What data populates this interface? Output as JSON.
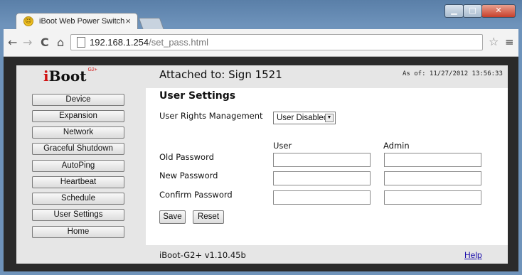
{
  "browser": {
    "tab_title": "iBoot Web Power Switch",
    "tab_close": "×",
    "url_host": "192.168.1.254",
    "url_path": "/set_pass.html"
  },
  "header": {
    "logo_text": "Boot",
    "logo_i": "i",
    "logo_sup": "G2+",
    "attached": "Attached to: Sign 1521",
    "as_of": "As of: 11/27/2012 13:56:33"
  },
  "sidebar": {
    "items": [
      {
        "label": "Device"
      },
      {
        "label": "Expansion"
      },
      {
        "label": "Network"
      },
      {
        "label": "Graceful Shutdown"
      },
      {
        "label": "AutoPing"
      },
      {
        "label": "Heartbeat"
      },
      {
        "label": "Schedule"
      },
      {
        "label": "User Settings"
      },
      {
        "label": "Home"
      }
    ]
  },
  "main": {
    "title": "User Settings",
    "rights_label": "User Rights Management",
    "rights_value": "User Disabled",
    "col_user": "User",
    "col_admin": "Admin",
    "rows": [
      {
        "label": "Old Password"
      },
      {
        "label": "New Password"
      },
      {
        "label": "Confirm Password"
      }
    ],
    "save_label": "Save",
    "reset_label": "Reset"
  },
  "footer": {
    "version": "iBoot-G2+ v1.10.45b",
    "help": "Help"
  },
  "icons": {
    "back": "back-arrow-icon",
    "forward": "forward-arrow-icon",
    "reload": "reload-icon",
    "home": "home-icon",
    "page": "page-icon",
    "star": "bookmark-star-icon",
    "menu": "menu-icon"
  }
}
